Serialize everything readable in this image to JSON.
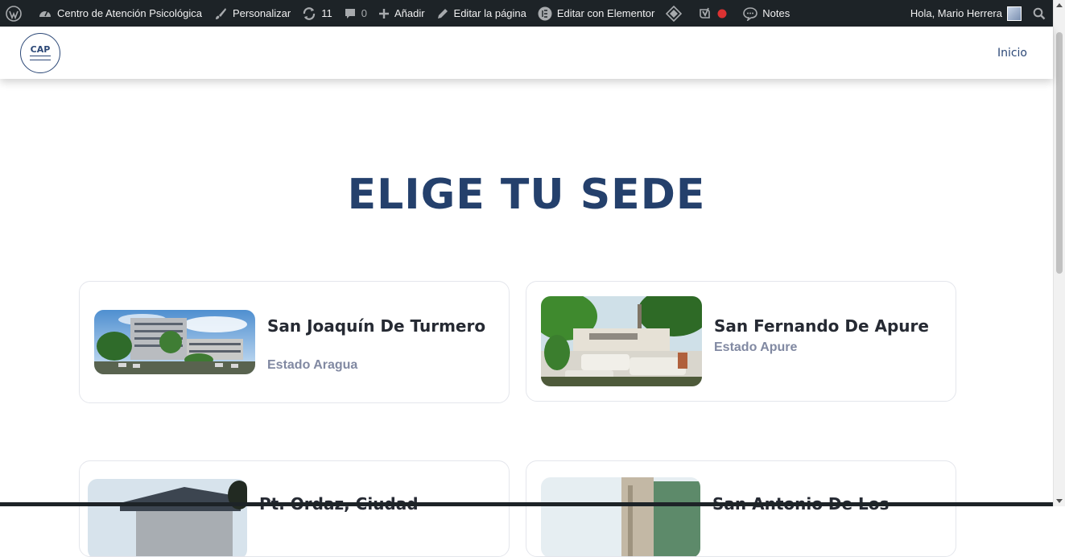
{
  "admin_bar": {
    "wp_logo": "wordpress-icon",
    "site_name": "Centro de Atención Psicológica",
    "customize": "Personalizar",
    "updates_count": "11",
    "comments_count": "0",
    "add_new": "Añadir",
    "edit_page": "Editar la página",
    "edit_elementor": "Editar con Elementor",
    "notes": "Notes",
    "greeting": "Hola, Mario Herrera"
  },
  "header": {
    "logo_text": "CAP",
    "nav": [
      "Inicio"
    ]
  },
  "main": {
    "title": "ELIGE TU SEDE",
    "sedes": [
      {
        "name": "San Joaquín De Turmero",
        "state": "Estado Aragua"
      },
      {
        "name": "San Fernando De Apure",
        "state": "Estado Apure"
      },
      {
        "name": "Pt. Ordaz, Ciudad",
        "state": ""
      },
      {
        "name": "San Antonio De Los",
        "state": ""
      }
    ]
  },
  "colors": {
    "admin_bar_bg": "#1d2327",
    "brand_blue": "#24406c",
    "state_gray": "#8189a2"
  }
}
